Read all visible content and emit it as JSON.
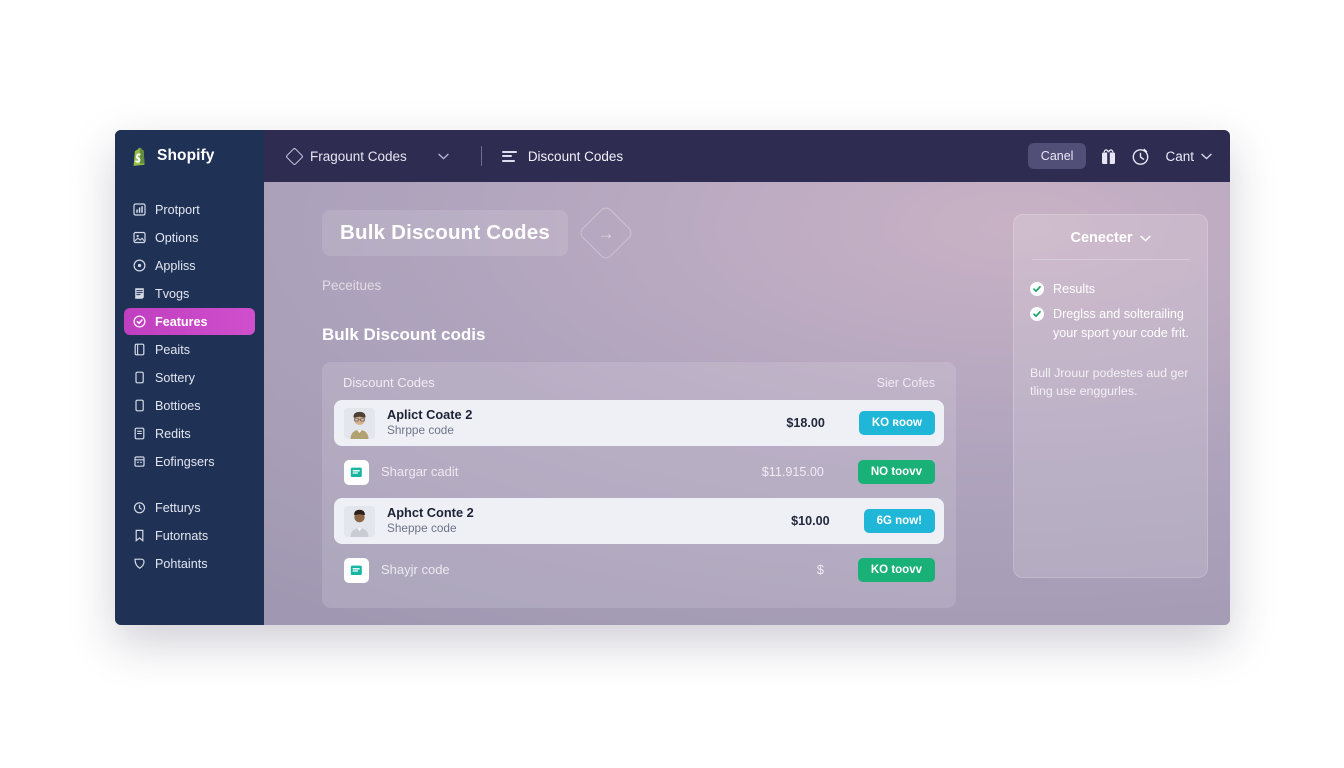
{
  "window": {
    "brand": {
      "name": "Shopify",
      "icon": "shopify-bag-icon"
    }
  },
  "topbar": {
    "nav_primary": {
      "label": "Fragount Codes",
      "icon": "diamond-icon",
      "caret": "chevron-down-icon"
    },
    "nav_secondary": {
      "label": "Discount Codes",
      "icon": "list-lines-icon"
    },
    "cancel_button": "Canel",
    "gift_icon": "gift-bag-icon",
    "timer_icon": "timer-icon",
    "cart_label": "Cant",
    "cart_caret": "chevron-down-icon"
  },
  "sidebar": {
    "groups": [
      {
        "items": [
          {
            "label": "Protport",
            "icon": "chart-icon"
          },
          {
            "label": "Options",
            "icon": "image-icon"
          },
          {
            "label": "Appliss",
            "icon": "target-icon"
          },
          {
            "label": "Tvogs",
            "icon": "receipt-icon"
          },
          {
            "label": "Features",
            "icon": "badge-icon",
            "active": true
          },
          {
            "label": "Peaits",
            "icon": "book-icon"
          },
          {
            "label": "Sottery",
            "icon": "file-icon"
          },
          {
            "label": "Bottioes",
            "icon": "file-icon"
          },
          {
            "label": "Redits",
            "icon": "note-icon"
          },
          {
            "label": "Eofingsers",
            "icon": "calendar-icon"
          }
        ]
      },
      {
        "items": [
          {
            "label": "Fetturys",
            "icon": "clock-icon"
          },
          {
            "label": "Futornats",
            "icon": "bookmark-icon"
          },
          {
            "label": "Pohtaints",
            "icon": "tag-icon"
          }
        ]
      }
    ]
  },
  "main": {
    "page_title": "Bulk Discount Codes",
    "title_arrow_icon": "arrow-right-diamond-icon",
    "subtitle": "Peceitues",
    "section_heading": "Bulk Discount codis",
    "card": {
      "header_left": "Discount Codes",
      "header_right": "Sier Cofes",
      "rows": [
        {
          "style": "light",
          "media": "avatar-photo",
          "title": "Aplict Coate 2",
          "subtitle": "Shrppe code",
          "amount": "$18.00",
          "button": {
            "label": "KO ʀoow",
            "color": "#1fb6d8"
          }
        },
        {
          "style": "plain",
          "media": "doc-icon",
          "title": "Shargar cadit",
          "subtitle": "",
          "amount": "$11.915.00",
          "button": {
            "label": "NO toovv",
            "color": "#19b177"
          }
        },
        {
          "style": "light",
          "media": "avatar-photo",
          "title": "Aphct Conte 2",
          "subtitle": "Sheppe code",
          "amount": "$10.00",
          "button": {
            "label": "6G now!",
            "color": "#1fb6d8"
          }
        },
        {
          "style": "plain",
          "media": "doc-icon",
          "title": "Shayjr code",
          "subtitle": "",
          "amount": "$",
          "button": {
            "label": "KO toovv",
            "color": "#19b177"
          }
        }
      ]
    }
  },
  "panel": {
    "title": "Cenecter",
    "caret_icon": "chevron-down-icon",
    "checks": [
      "Results",
      "Dreglss and solterailing your sport your code frit."
    ],
    "paragraph": "Bull Jrouur podestes aud ger tling use enggurles."
  },
  "colors": {
    "sidebar_bg": "#1f3256",
    "topbar_bg": "#2e2c51",
    "active_item": "#c03fc0",
    "button_cyan": "#1fb6d8",
    "button_green": "#19b177",
    "check_green": "#19a368"
  }
}
